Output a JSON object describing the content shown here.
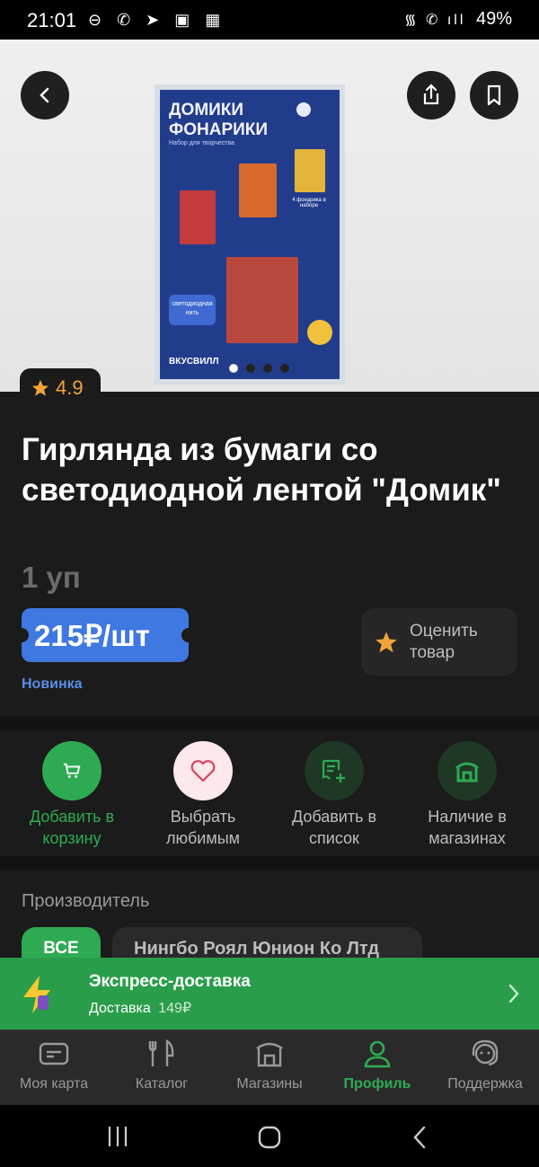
{
  "status_bar": {
    "time": "21:01",
    "battery": "49%"
  },
  "product": {
    "rating": "4.9",
    "title": "Гирлянда из бумаги со светодиодной лентой \"Домик\"",
    "unit": "1 уп",
    "price": "215₽/шт",
    "rate_button": "Оценить товар",
    "new_label": "Новинка",
    "package": {
      "title": "ДОМИКИ ФОНАРИКИ",
      "subtitle": "Набор для творчества",
      "brand": "ВКУСВИЛЛ",
      "badge": "4 фонарика в наборе",
      "led_label": "светодиодная нить"
    }
  },
  "carousel": {
    "count": 4,
    "active_index": 0
  },
  "actions": [
    {
      "label": "Добавить в корзину",
      "icon": "cart-icon",
      "color": "#2eab52"
    },
    {
      "label": "Выбрать любимым",
      "icon": "heart-icon",
      "color": "#d9405f"
    },
    {
      "label": "Добавить в список",
      "icon": "list-add-icon",
      "color": "#2eab52"
    },
    {
      "label": "Наличие в магазинах",
      "icon": "store-icon",
      "color": "#2eab52"
    }
  ],
  "manufacturer": {
    "heading": "Производитель",
    "chips": [
      "ВСЕ",
      "Нингбо Роял Юнион Ко Лтд"
    ]
  },
  "express": {
    "title": "Экспресс-доставка",
    "delivery_label": "Доставка",
    "delivery_price": "149₽"
  },
  "bottom_nav": [
    {
      "label": "Моя карта",
      "icon": "card-icon"
    },
    {
      "label": "Каталог",
      "icon": "cutlery-icon"
    },
    {
      "label": "Магазины",
      "icon": "store-icon"
    },
    {
      "label": "Профиль",
      "icon": "profile-icon",
      "active": true
    },
    {
      "label": "Поддержка",
      "icon": "support-icon"
    }
  ],
  "colors": {
    "accent_green": "#2eab52",
    "price_blue": "#3f78e0",
    "rating_orange": "#f2a33a",
    "background": "#1b1b1b"
  }
}
